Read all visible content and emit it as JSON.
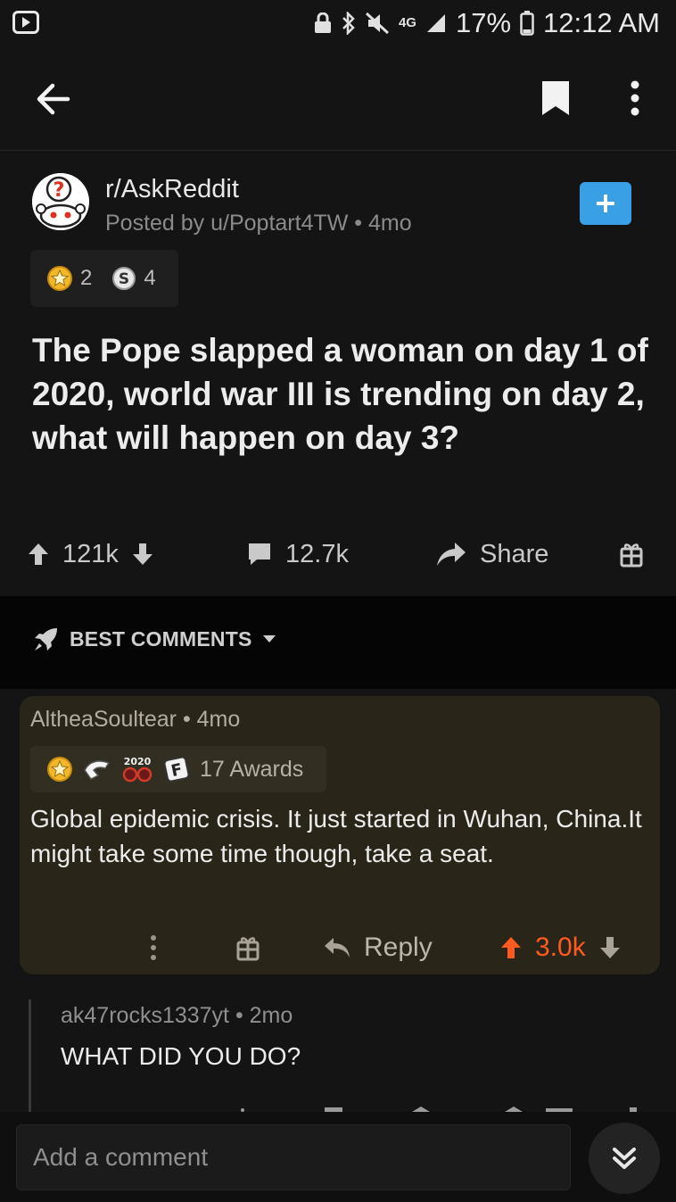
{
  "status_bar": {
    "network": "4G",
    "battery": "17%",
    "time": "12:12 AM"
  },
  "post": {
    "subreddit": "r/AskReddit",
    "meta": "Posted by u/Poptart4TW • 4mo",
    "awards": [
      {
        "icon": "gold-award-icon",
        "count": "2"
      },
      {
        "icon": "silver-s-award-icon",
        "count": "4"
      }
    ],
    "title": "The Pope slapped a woman on day 1 of 2020, world war III is trending on day 2, what will happen on day 3?",
    "upvotes": "121k",
    "comments": "12.7k",
    "share_label": "Share"
  },
  "sort": {
    "label": "BEST COMMENTS"
  },
  "comment": {
    "author_meta": "AltheaSoultear • 4mo",
    "awards_label": "17 Awards",
    "award_icons": [
      "gold-award-icon",
      "hand-award-icon",
      "2020-award-icon",
      "f-award-icon"
    ],
    "body": "Global epidemic crisis. It just started in Wuhan, China.It might take some time though, take a seat.",
    "reply_label": "Reply",
    "score": "3.0k",
    "score_color": "#ff5a1f"
  },
  "reply": {
    "author_meta": "ak47rocks1337yt • 2mo",
    "body": "WHAT DID YOU DO?"
  },
  "composer": {
    "placeholder": "Add a comment"
  },
  "colors": {
    "background": "#141414",
    "comment_bg": "#2a2519",
    "join_blue": "#3aa0e6",
    "upvote_orange": "#ff5a1f"
  }
}
